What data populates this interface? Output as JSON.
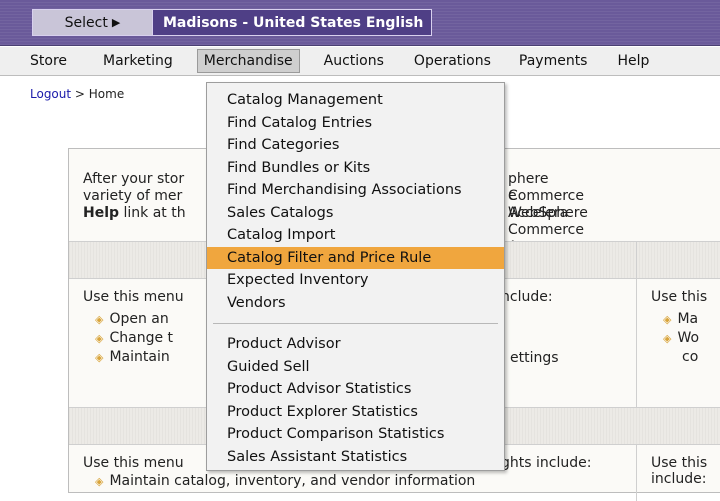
{
  "topbar": {
    "select_label": "Select",
    "store_title": "Madisons - United States English"
  },
  "menubar": {
    "items": [
      "Store",
      "Marketing",
      "Merchandise",
      "Auctions",
      "Operations",
      "Payments",
      "Help"
    ],
    "active": "Merchandise"
  },
  "breadcrumb": {
    "logout": "Logout",
    "separator": " > ",
    "home": "Home"
  },
  "content": {
    "intro_line1": "After your stor",
    "intro_line1b": "phere Commerce Accelera",
    "intro_line2": "variety of mer",
    "intro_line2b": "e WebSphere Commerce A",
    "intro_help": "Help",
    "intro_line3": " link at th",
    "sec1_left": "Use this menu",
    "sec1_mid": "nclude:",
    "sec1_right": "Use this",
    "sec1_bullets": [
      "Open an",
      "Change t",
      "Maintain"
    ],
    "sec1_mid_bullet": "ettings",
    "sec1_right_bullets": [
      "Ma",
      "Wo"
    ],
    "sec1_right_extra": "co",
    "sec2_left": "Use this menu",
    "sec2_mid": "ghts include:",
    "sec2_right": "Use this",
    "sec2_right2": "include:",
    "sec2_bottom": "Maintain catalog, inventory, and vendor information"
  },
  "dropdown": {
    "group1": [
      "Catalog Management",
      "Find Catalog Entries",
      "Find Categories",
      "Find Bundles or Kits",
      "Find Merchandising Associations",
      "Sales Catalogs",
      "Catalog Import",
      "Catalog Filter and Price Rule",
      "Expected Inventory",
      "Vendors"
    ],
    "group2": [
      "Product Advisor",
      "Guided Sell",
      "Product Advisor Statistics",
      "Product Explorer Statistics",
      "Product Comparison Statistics",
      "Sales Assistant Statistics"
    ],
    "highlighted": "Catalog Filter and Price Rule",
    "highlight_color": "#f0a63e"
  },
  "colors": {
    "topbar": "#6a5a9a",
    "title_bar": "#4f3f86",
    "bullet": "#d9a43a"
  }
}
